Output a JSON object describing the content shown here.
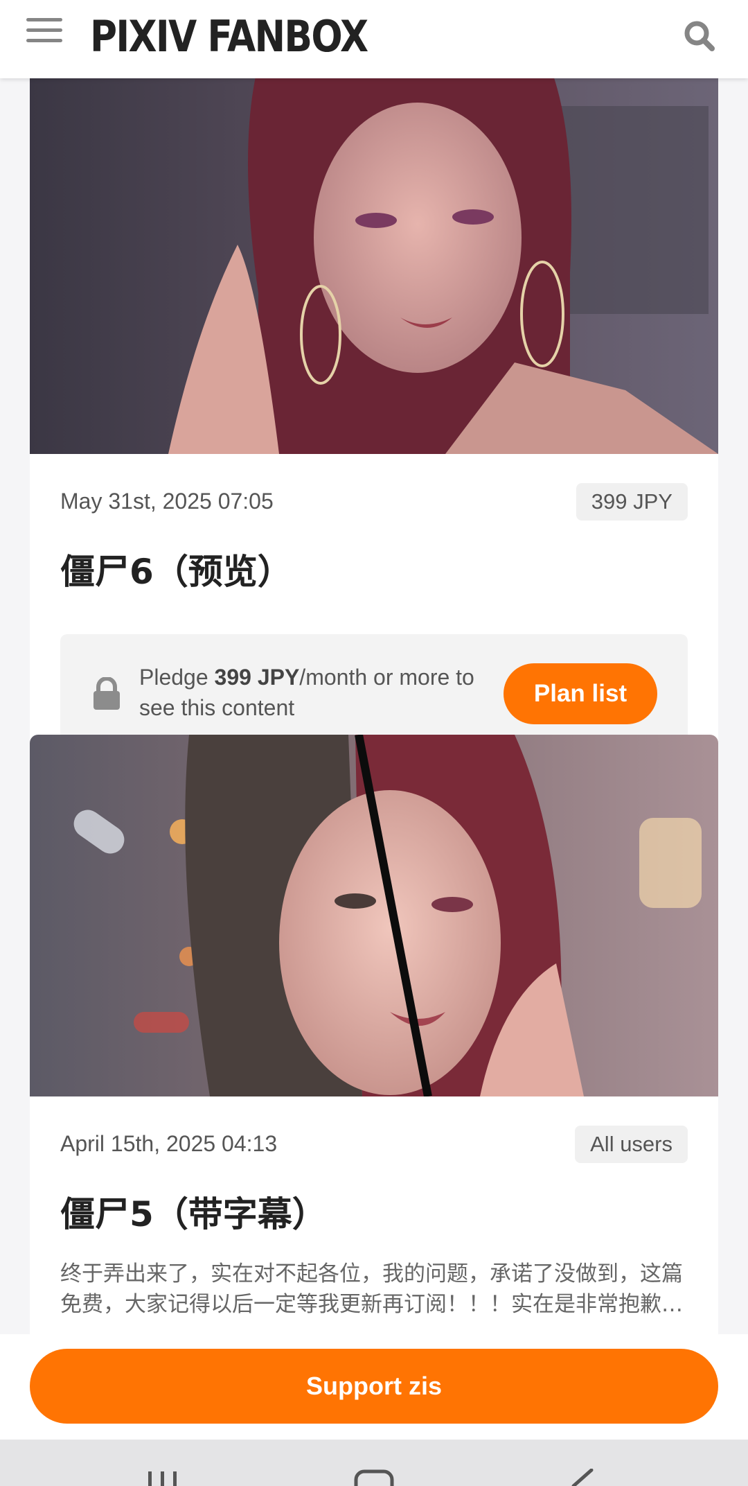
{
  "header": {
    "logo": "PIXIV FANBOX",
    "menu_icon": "hamburger-menu-icon",
    "search_icon": "search-icon"
  },
  "posts": [
    {
      "date": "May 31st, 2025 07:05",
      "price": "399 JPY",
      "title": "僵尸6（预览）",
      "locked": true,
      "pledge_prefix": "Pledge ",
      "pledge_amount": "399 JPY",
      "pledge_suffix": "/month or more to see this content",
      "plan_button": "Plan list",
      "lock_icon": "lock-icon"
    },
    {
      "date": "April 15th, 2025 04:13",
      "price": "All users",
      "title": "僵尸5（带字幕）",
      "locked": false,
      "excerpt": "终于弄出来了，实在对不起各位，我的问题，承诺了没做到，这篇免费，大家记得以后一定等我更新再订阅！！！实在是非常抱歉…"
    }
  ],
  "support_button": "Support zis",
  "colors": {
    "accent": "#ff7403",
    "background": "#f5f5f7",
    "card": "#ffffff"
  },
  "system_nav": {
    "recent_icon": "recent-apps-icon",
    "home_icon": "home-icon",
    "back_icon": "back-icon"
  }
}
